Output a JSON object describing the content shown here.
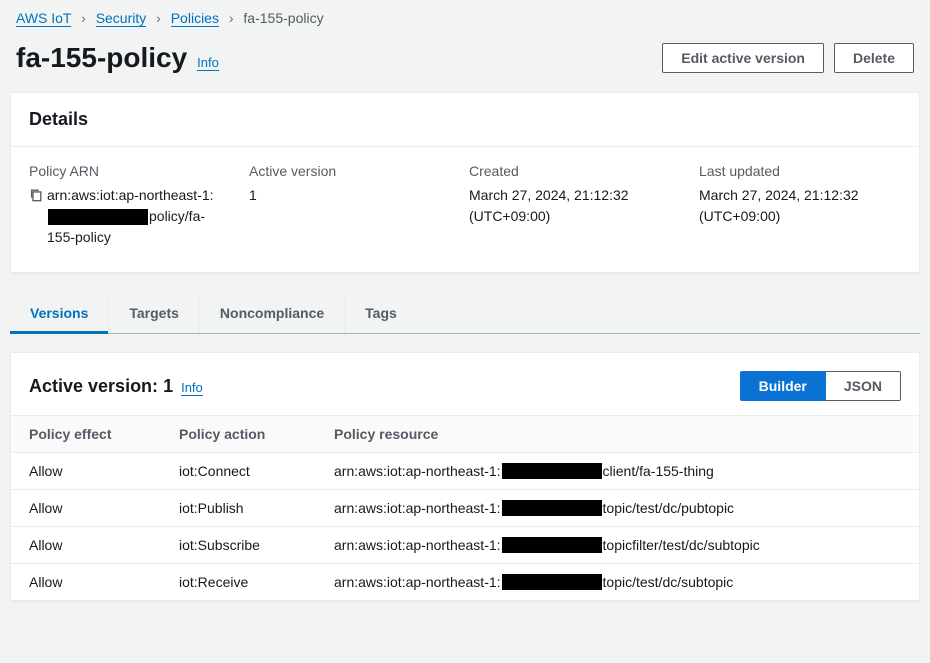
{
  "breadcrumb": {
    "items": [
      "AWS IoT",
      "Security",
      "Policies"
    ],
    "current": "fa-155-policy"
  },
  "page": {
    "title": "fa-155-policy",
    "info_label": "Info",
    "edit_button": "Edit active version",
    "delete_button": "Delete"
  },
  "details": {
    "heading": "Details",
    "arn_label": "Policy ARN",
    "arn_prefix": "arn:aws:iot:ap-northeast-1:",
    "arn_suffix": "policy/fa-155-policy",
    "active_version_label": "Active version",
    "active_version_value": "1",
    "created_label": "Created",
    "created_value": "March 27, 2024, 21:12:32 (UTC+09:00)",
    "updated_label": "Last updated",
    "updated_value": "March 27, 2024, 21:12:32 (UTC+09:00)"
  },
  "tabs": {
    "versions": "Versions",
    "targets": "Targets",
    "noncompliance": "Noncompliance",
    "tags": "Tags"
  },
  "version_panel": {
    "title_prefix": "Active version: ",
    "title_number": "1",
    "info_label": "Info",
    "builder_label": "Builder",
    "json_label": "JSON",
    "columns": {
      "effect": "Policy effect",
      "action": "Policy action",
      "resource": "Policy resource"
    },
    "resource_prefix": "arn:aws:iot:ap-northeast-1:",
    "rows": [
      {
        "effect": "Allow",
        "action": "iot:Connect",
        "suffix": "client/fa-155-thing"
      },
      {
        "effect": "Allow",
        "action": "iot:Publish",
        "suffix": "topic/test/dc/pubtopic"
      },
      {
        "effect": "Allow",
        "action": "iot:Subscribe",
        "suffix": "topicfilter/test/dc/subtopic"
      },
      {
        "effect": "Allow",
        "action": "iot:Receive",
        "suffix": "topic/test/dc/subtopic"
      }
    ]
  }
}
